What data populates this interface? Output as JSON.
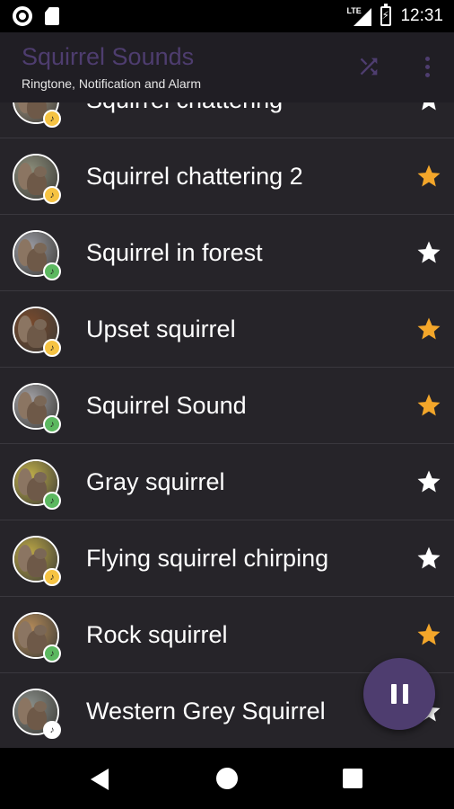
{
  "status_bar": {
    "network": "LTE",
    "time": "12:31",
    "icons": [
      "record-icon",
      "sd-card-icon",
      "signal-icon",
      "battery-charging-icon"
    ]
  },
  "app_bar": {
    "title": "Squirrel Sounds",
    "subtitle": "Ringtone, Notification and Alarm",
    "shuffle_icon": "shuffle-icon",
    "more_icon": "more-vertical-icon"
  },
  "colors": {
    "accent": "#4e3d6f",
    "background": "#262429",
    "appbar": "#201e24",
    "star_favorite": "#f3a62a",
    "star_default": "#ffffff",
    "badge_yellow": "#f6c343",
    "badge_green": "#5cb860"
  },
  "sounds": [
    {
      "title": "Squirrel chattering",
      "favorite": false,
      "badge": "yellow",
      "photo": "#a69a86"
    },
    {
      "title": "Squirrel chattering 2",
      "favorite": true,
      "badge": "yellow",
      "photo": "#8d8f7c"
    },
    {
      "title": "Squirrel in forest",
      "favorite": false,
      "badge": "green",
      "photo": "#9b9ca4"
    },
    {
      "title": "Upset squirrel",
      "favorite": true,
      "badge": "yellow",
      "photo": "#7a4a2c"
    },
    {
      "title": "Squirrel Sound",
      "favorite": true,
      "badge": "green",
      "photo": "#a4a3a8"
    },
    {
      "title": "Gray squirrel",
      "favorite": false,
      "badge": "green",
      "photo": "#c2b14a"
    },
    {
      "title": "Flying squirrel chirping",
      "favorite": false,
      "badge": "yellow",
      "photo": "#bca846"
    },
    {
      "title": "Rock squirrel",
      "favorite": true,
      "badge": "green",
      "photo": "#b78d5a"
    },
    {
      "title": "Western Grey Squirrel",
      "favorite": false,
      "badge": "white",
      "photo": "#8a8f8a"
    }
  ],
  "player": {
    "state": "playing",
    "icon": "pause-icon"
  },
  "nav_bar": {
    "icons": [
      "back-icon",
      "home-icon",
      "recents-icon"
    ]
  }
}
